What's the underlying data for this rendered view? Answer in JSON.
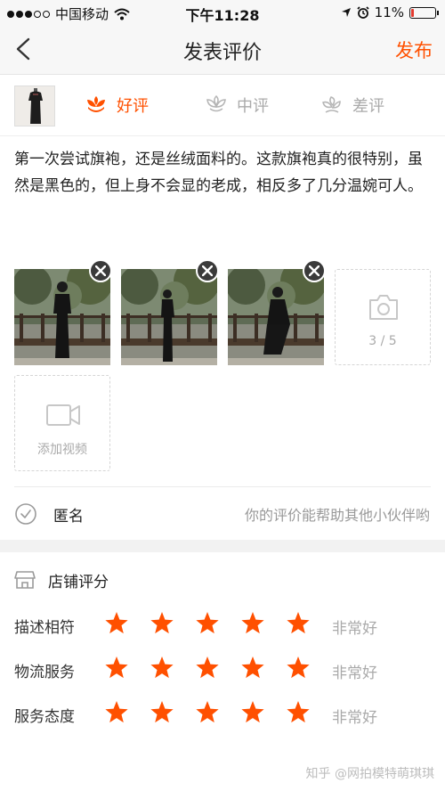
{
  "status_bar": {
    "carrier": "中国移动",
    "time": "下午11:28",
    "battery_text": "11%",
    "battery_level": 0.11,
    "battery_color": "#e23a2e"
  },
  "nav": {
    "title": "发表评价",
    "publish_label": "发布",
    "accent_color": "#ff5000"
  },
  "rating_tabs": [
    {
      "label": "好评",
      "icon": "flower-icon",
      "active": true
    },
    {
      "label": "中评",
      "icon": "neutral-flower-icon",
      "active": false
    },
    {
      "label": "差评",
      "icon": "wilted-flower-icon",
      "active": false
    }
  ],
  "review": {
    "text": "第一次尝试旗袍，还是丝绒面料的。这款旗袍真的很特别，虽然是黑色的，但上身不会显的老成，相反多了几分温婉可人。"
  },
  "media": {
    "photo_count_label": "3 / 5",
    "add_video_label": "添加视频",
    "camera_icon": "camera-icon",
    "video_icon": "video-camera-icon"
  },
  "anonymous": {
    "label": "匿名",
    "hint": "你的评价能帮助其他小伙伴哟"
  },
  "shop_rating": {
    "title": "店铺评分",
    "star_color": "#ff5000",
    "rows": [
      {
        "label": "描述相符",
        "stars": 5,
        "max_stars": 5,
        "text": "非常好"
      },
      {
        "label": "物流服务",
        "stars": 5,
        "max_stars": 5,
        "text": "非常好"
      },
      {
        "label": "服务态度",
        "stars": 5,
        "max_stars": 5,
        "text": "非常好"
      }
    ]
  },
  "watermark": "知乎 @网拍模特萌琪琪"
}
